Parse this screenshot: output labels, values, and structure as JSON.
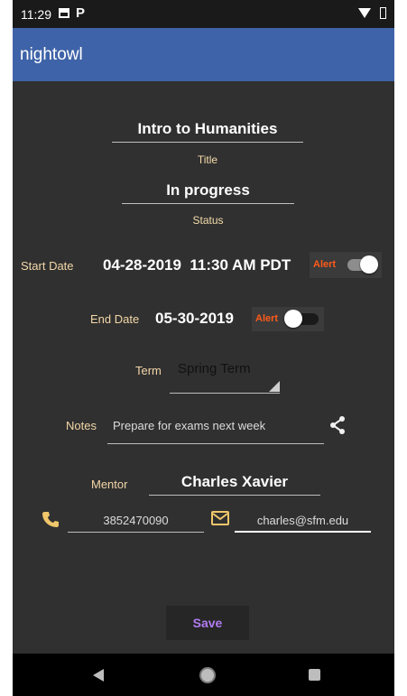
{
  "status_bar": {
    "time": "11:29",
    "icons": [
      "image-icon",
      "parking-icon",
      "wifi-icon",
      "battery-icon"
    ]
  },
  "app_bar": {
    "title": "nightowl",
    "color": "#3f63a8"
  },
  "form": {
    "course_title": "Intro to Humanities",
    "title_hint": "Title",
    "status": "In progress",
    "status_hint": "Status",
    "start_date_label": "Start Date",
    "start_date_value": "04-28-2019  11:30 AM PDT",
    "start_alert_label": "Alert",
    "start_alert_on": true,
    "end_date_label": "End Date",
    "end_date_value": "05-30-2019",
    "end_alert_label": "Alert",
    "end_alert_on": false,
    "term_label": "Term",
    "term_value": "Spring Term",
    "notes_label": "Notes",
    "notes_value": "Prepare for exams next week",
    "mentor_label": "Mentor",
    "mentor_value": "Charles Xavier",
    "phone_value": "3852470090",
    "email_value": "charles@sfm.edu"
  },
  "save_label": "Save",
  "colors": {
    "background": "#303030",
    "label": "#f3d7a8",
    "alert": "#ff5a1a",
    "save_text": "#b07cf0"
  }
}
